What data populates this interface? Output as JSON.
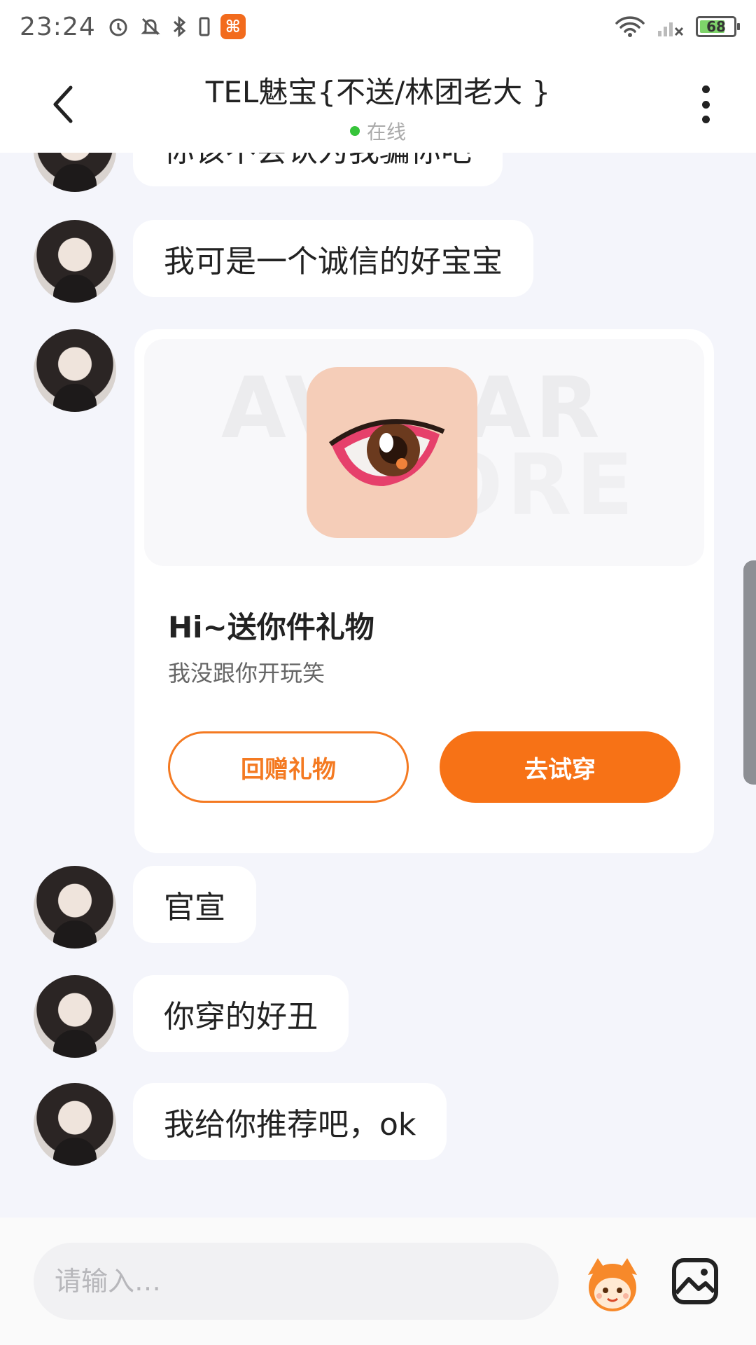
{
  "status_bar": {
    "time": "23:24",
    "icons_left": [
      "alarm-icon",
      "mute-icon",
      "bluetooth-icon",
      "vibrate-icon",
      "app-notification-icon"
    ],
    "icons_right": [
      "wifi-icon",
      "signal-icon"
    ],
    "battery": "68"
  },
  "header": {
    "title": "TEL魅宝{不送/林团老大 }",
    "status": "在线",
    "status_color": "#36c43a"
  },
  "messages": [
    {
      "text": "你该不会认为我骗你吧"
    },
    {
      "text": "我可是一个诚信的好宝宝"
    },
    {
      "text": "官宣"
    },
    {
      "text": "你穿的好丑"
    },
    {
      "text": "我给你推荐吧，ok"
    }
  ],
  "gift_card": {
    "title": "Hi~送你件礼物",
    "subtitle": "我没跟你开玩笑",
    "watermark_line1": "AVATAR",
    "watermark_line2": "STORE",
    "return_gift_label": "回赠礼物",
    "try_on_label": "去试穿",
    "accent_color": "#f77216"
  },
  "input": {
    "placeholder": "请输入…"
  }
}
